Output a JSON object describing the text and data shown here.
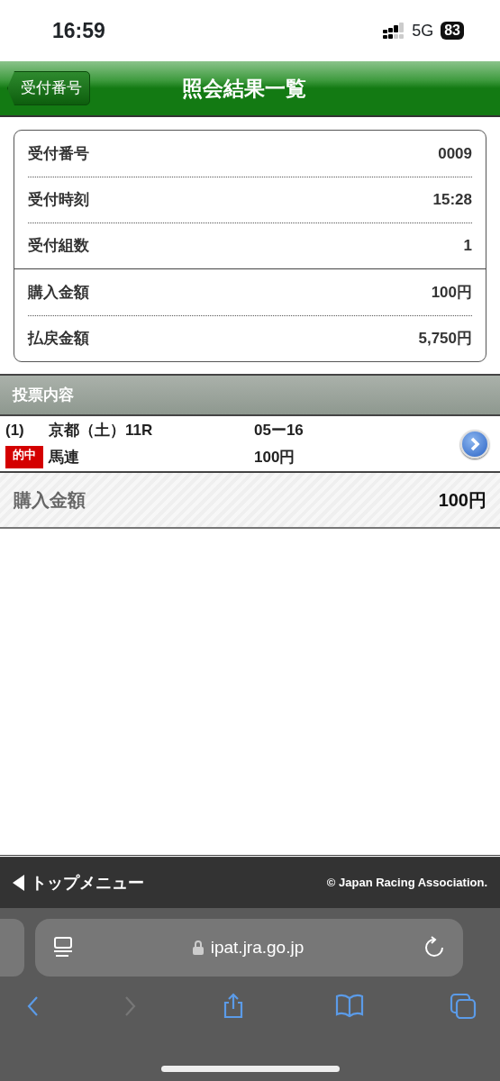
{
  "status_bar": {
    "time": "16:59",
    "network": "5G",
    "battery": "83"
  },
  "header": {
    "back_button": "受付番号",
    "title": "照会結果一覧"
  },
  "summary": [
    {
      "rows": [
        {
          "label": "受付番号",
          "value": "0009"
        },
        {
          "label": "受付時刻",
          "value": "15:28"
        },
        {
          "label": "受付組数",
          "value": "1"
        }
      ]
    },
    {
      "rows": [
        {
          "label": "購入金額",
          "value": "100円"
        },
        {
          "label": "払戻金額",
          "value": "5,750円"
        }
      ]
    }
  ],
  "section": {
    "title": "投票内容"
  },
  "bets": [
    {
      "number": "(1)",
      "race": "京都（土）11R",
      "combination": "05ー16",
      "badge": "的中",
      "bet_type": "馬連",
      "amount": "100円"
    }
  ],
  "total": {
    "label": "購入金額",
    "value": "100円"
  },
  "footer": {
    "menu_link": "トップメニュー",
    "copyright": "© Japan Racing Association."
  },
  "browser": {
    "url": "ipat.jra.go.jp",
    "toolbar": [
      {
        "kind": "back",
        "disabled": false
      },
      {
        "kind": "forward",
        "disabled": true
      },
      {
        "kind": "share",
        "disabled": false
      },
      {
        "kind": "bookmarks",
        "disabled": false
      },
      {
        "kind": "tabs",
        "disabled": false
      }
    ]
  }
}
